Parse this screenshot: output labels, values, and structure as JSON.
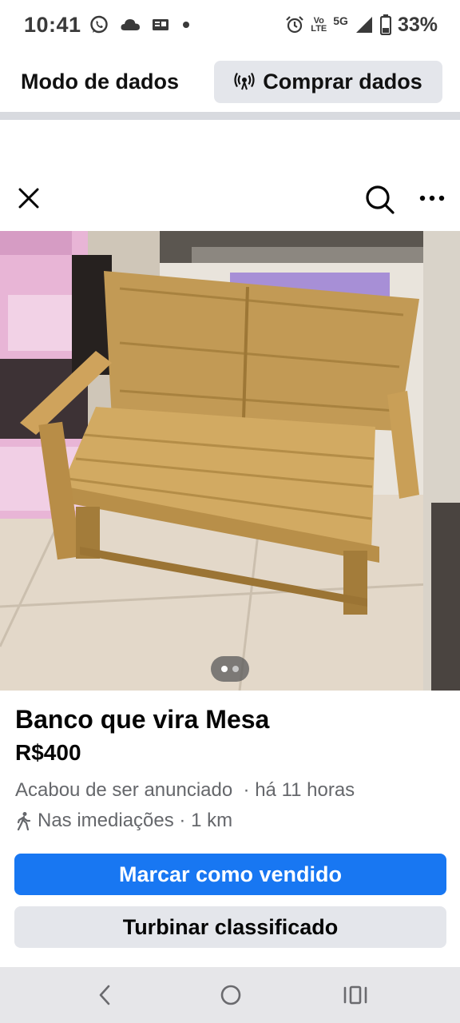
{
  "status_bar": {
    "time": "10:41",
    "network_top": "Vo",
    "network_bottom": "LTE",
    "network_type": "5G",
    "battery": "33%",
    "icons": [
      "whatsapp-icon",
      "cloud-icon",
      "news-icon",
      "dot-icon",
      "alarm-icon",
      "signal-icon",
      "battery-icon"
    ]
  },
  "data_bar": {
    "mode_label": "Modo de dados",
    "buy_label": "Comprar dados"
  },
  "top_nav": {
    "icons": [
      "close-icon",
      "search-icon",
      "more-icon"
    ]
  },
  "listing": {
    "title": "Banco que vira Mesa",
    "price": "R$400",
    "posted": "Acabou de ser anunciado  · há 11 horas",
    "location": "Nas imediações · 1 km"
  },
  "actions": {
    "mark_sold": "Marcar como vendido",
    "boost": "Turbinar classificado"
  },
  "pager": {
    "total": 2,
    "current": 1
  },
  "colors": {
    "primary": "#1877f2",
    "secondary_button": "#e4e6eb",
    "muted_text": "#65676b"
  }
}
